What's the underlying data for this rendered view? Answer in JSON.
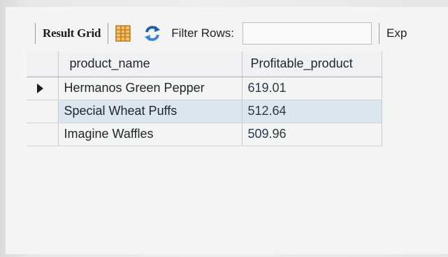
{
  "toolbar": {
    "result_grid_label": "Result Grid",
    "filter_rows_label": "Filter Rows:",
    "filter_value": "",
    "export_label": "Exp"
  },
  "table": {
    "headers": [
      "product_name",
      "Profitable_product"
    ],
    "rows": [
      {
        "product_name": "Hermanos Green Pepper",
        "value": "619.01"
      },
      {
        "product_name": "Special Wheat Puffs",
        "value": "512.64"
      },
      {
        "product_name": "Imagine Waffles",
        "value": "509.96"
      }
    ]
  },
  "colors": {
    "selected_row": "#dbe6ef",
    "icon_blue": "#1f5fa8",
    "icon_orange": "#e0982d"
  },
  "icons": [
    "grid-toggle-icon",
    "refresh-icon",
    "current-row-arrow-icon"
  ]
}
